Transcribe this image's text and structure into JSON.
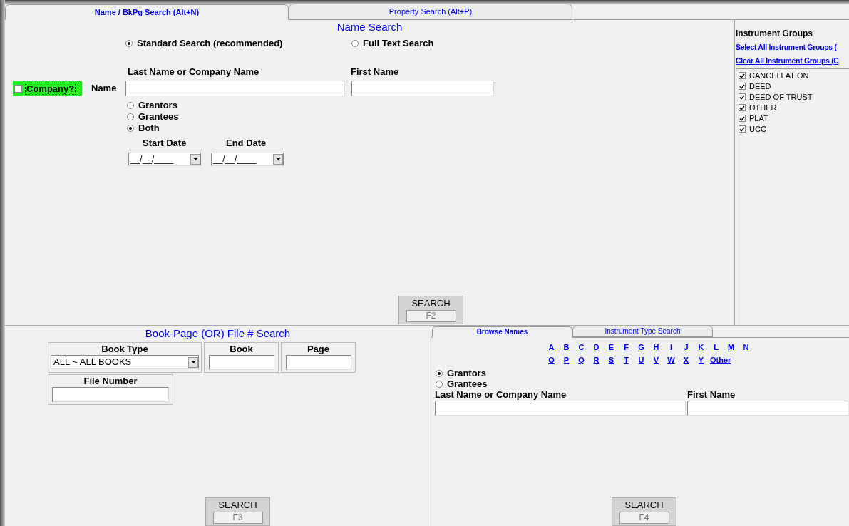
{
  "tabs": [
    {
      "label": "Name / BkPg Search (Alt+N)",
      "selected": true
    },
    {
      "label": "Property Search (Alt+P)",
      "selected": false
    }
  ],
  "name_search": {
    "title": "Name Search",
    "modes": [
      {
        "label": "Standard Search (recommended)",
        "selected": true
      },
      {
        "label": "Full Text Search",
        "selected": false
      }
    ],
    "company": {
      "label": "Company?",
      "checked": false
    },
    "name_label": "Name",
    "last_name": {
      "label": "Last Name or Company Name"
    },
    "first_name": {
      "label": "First Name"
    },
    "parties": [
      {
        "label": "Grantors",
        "selected": false
      },
      {
        "label": "Grantees",
        "selected": false
      },
      {
        "label": "Both",
        "selected": true
      }
    ],
    "start_date": {
      "label": "Start Date",
      "value": "__/__/____"
    },
    "end_date": {
      "label": "End Date",
      "value": "__/__/____"
    },
    "search_button": {
      "label": "SEARCH",
      "key": "F2"
    }
  },
  "instrument_groups": {
    "title": "Instrument Groups",
    "select_all": "Select All Instrument Groups (",
    "clear_all": "Clear All Instrument Groups (C",
    "items": [
      {
        "label": "CANCELLATION",
        "checked": true
      },
      {
        "label": "DEED",
        "checked": true
      },
      {
        "label": "DEED OF TRUST",
        "checked": true
      },
      {
        "label": "OTHER",
        "checked": true
      },
      {
        "label": "PLAT",
        "checked": true
      },
      {
        "label": "UCC",
        "checked": true
      }
    ]
  },
  "book_page_search": {
    "title": "Book-Page (OR) File # Search",
    "book_type": {
      "label": "Book Type",
      "value": "ALL ~ ALL BOOKS"
    },
    "book": {
      "label": "Book"
    },
    "page": {
      "label": "Page"
    },
    "file_number": {
      "label": "File Number"
    },
    "search_button": {
      "label": "SEARCH",
      "key": "F3"
    }
  },
  "browse_tabs": [
    {
      "label": "Browse Names",
      "selected": true
    },
    {
      "label": "Instrument Type Search",
      "selected": false
    }
  ],
  "browse_names": {
    "letter_rows": [
      [
        "A",
        "B",
        "C",
        "D",
        "E",
        "F",
        "G",
        "H",
        "I",
        "J",
        "K",
        "L",
        "M",
        "N"
      ],
      [
        "O",
        "P",
        "Q",
        "R",
        "S",
        "T",
        "U",
        "V",
        "W",
        "X",
        "Y",
        "Other"
      ]
    ],
    "parties": [
      {
        "label": "Grantors",
        "selected": true
      },
      {
        "label": "Grantees",
        "selected": false
      }
    ],
    "last_name": {
      "label": "Last Name or Company Name"
    },
    "first_name": {
      "label": "First Name"
    },
    "search_button": {
      "label": "SEARCH",
      "key": "F4"
    }
  }
}
